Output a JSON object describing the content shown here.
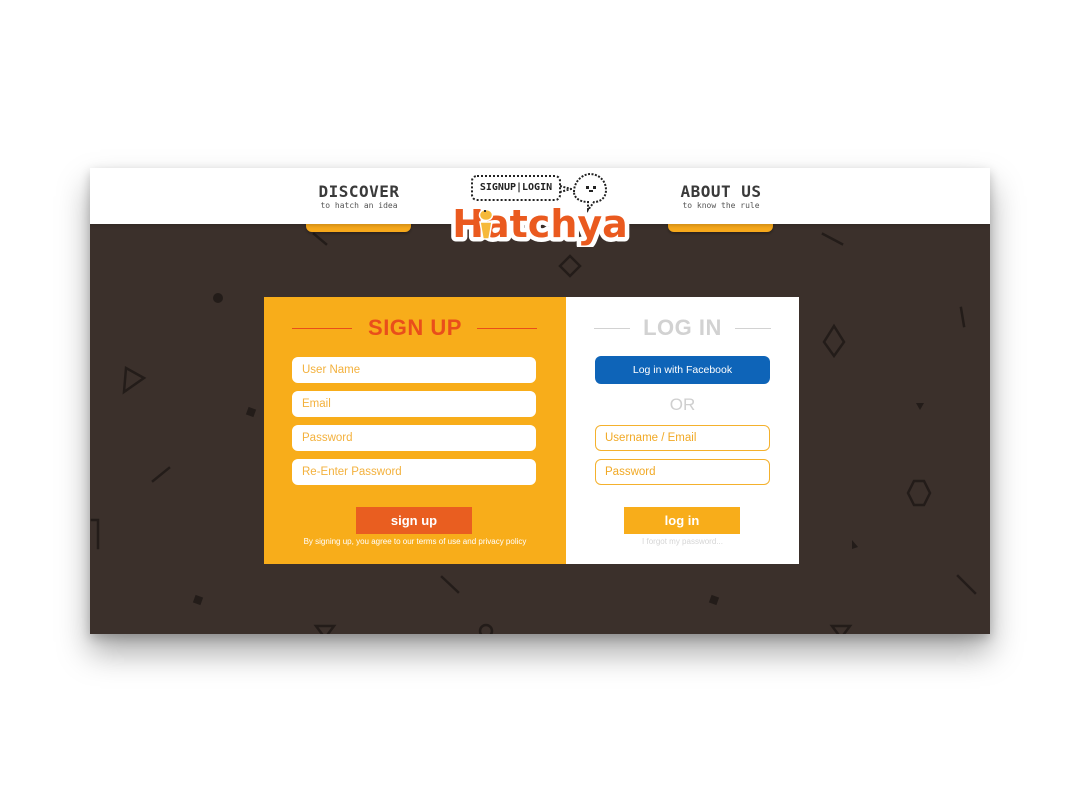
{
  "header": {
    "nav_left": {
      "title": "DISCOVER",
      "subtitle": "to hatch an idea"
    },
    "nav_right": {
      "title": "ABOUT US",
      "subtitle": "to know the rule"
    },
    "bubble_label": "SIGNUP|LOGIN",
    "logo_text": "Hatchya"
  },
  "signup": {
    "title": "SIGN UP",
    "username_placeholder": "User Name",
    "email_placeholder": "Email",
    "password_placeholder": "Password",
    "reenter_placeholder": "Re-Enter Password",
    "button_label": "sign up",
    "terms_text": "By signing up, you agree to our terms of use and privacy policy"
  },
  "login": {
    "title": "LOG IN",
    "facebook_label": "Log in with Facebook",
    "or_text": "OR",
    "username_placeholder": "Username / Email",
    "password_placeholder": "Password",
    "button_label": "log in",
    "forgot_text": "I forgot my password..."
  },
  "colors": {
    "background": "#3b302b",
    "signup_panel": "#f8ad1a",
    "accent_orange": "#e94e1b",
    "facebook_blue": "#0e64b8"
  }
}
